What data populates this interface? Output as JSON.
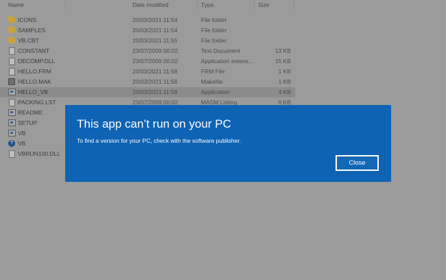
{
  "columns": {
    "name": "Name",
    "date": "Date modified",
    "type": "Type",
    "size": "Size"
  },
  "files": [
    {
      "name": "ICONS",
      "date": "20/03/2021 11:54",
      "type": "File folder",
      "size": "",
      "icon": "folder-icon"
    },
    {
      "name": "SAMPLES",
      "date": "20/03/2021 11:54",
      "type": "File folder",
      "size": "",
      "icon": "folder-icon"
    },
    {
      "name": "VB.CBT",
      "date": "20/03/2021 11:55",
      "type": "File folder",
      "size": "",
      "icon": "folder-icon"
    },
    {
      "name": "CONSTANT",
      "date": "23/07/2009 00:02",
      "type": "Text Document",
      "size": "13 KB",
      "icon": "text-document-icon"
    },
    {
      "name": "DECOMP.DLL",
      "date": "23/07/2009 00:02",
      "type": "Application extens...",
      "size": "15 KB",
      "icon": "dll-file-icon"
    },
    {
      "name": "HELLO.FRM",
      "date": "20/03/2021 11:58",
      "type": "FRM File",
      "size": "1 KB",
      "icon": "file-icon"
    },
    {
      "name": "HELLO.MAK",
      "date": "20/03/2021 11:58",
      "type": "Makefile",
      "size": "1 KB",
      "icon": "makefile-icon"
    },
    {
      "name": "HELLO_VB",
      "date": "20/03/2021 11:58",
      "type": "Application",
      "size": "4 KB",
      "icon": "application-icon",
      "selected": true
    },
    {
      "name": "PACKING.LST",
      "date": "23/07/2009 00:02",
      "type": "MASM Listing",
      "size": "6 KB",
      "icon": "file-icon"
    },
    {
      "name": "README",
      "date": "",
      "type": "",
      "size": "",
      "icon": "application-icon"
    },
    {
      "name": "SETUP",
      "date": "",
      "type": "",
      "size": "",
      "icon": "application-icon"
    },
    {
      "name": "VB",
      "date": "",
      "type": "",
      "size": "",
      "icon": "application-icon"
    },
    {
      "name": "VB",
      "date": "",
      "type": "",
      "size": "",
      "icon": "help-file-icon"
    },
    {
      "name": "VBRUN100.DLL",
      "date": "",
      "type": "",
      "size": "",
      "icon": "dll-file-icon"
    }
  ],
  "dialog": {
    "title": "This app can’t run on your PC",
    "message": "To find a version for your PC, check with the software publisher.",
    "close_label": "Close"
  },
  "colors": {
    "dialog_bg": "#0f63b4",
    "overlay": "#9b9b9b"
  }
}
